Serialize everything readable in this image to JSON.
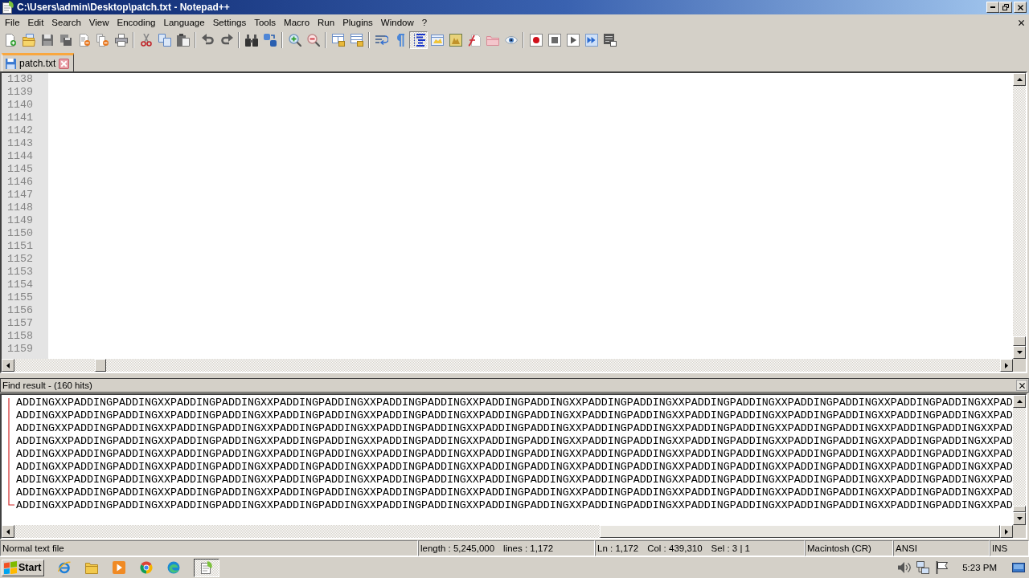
{
  "window": {
    "title": "C:\\Users\\admin\\Desktop\\patch.txt - Notepad++"
  },
  "menu": [
    "File",
    "Edit",
    "Search",
    "View",
    "Encoding",
    "Language",
    "Settings",
    "Tools",
    "Macro",
    "Run",
    "Plugins",
    "Window",
    "?"
  ],
  "toolbar": [
    [
      {
        "on": false
      },
      {
        "on": false
      },
      {
        "on": false
      },
      {
        "on": false
      },
      {
        "on": false
      },
      {
        "on": false
      },
      {
        "on": false
      }
    ],
    [
      {
        "on": false
      },
      {
        "on": false
      },
      {
        "on": false
      }
    ],
    [
      {
        "on": false
      },
      {
        "on": false
      }
    ],
    [
      {
        "on": false
      },
      {
        "on": false
      }
    ],
    [
      {
        "on": false
      },
      {
        "on": false
      }
    ],
    [
      {
        "on": false
      },
      {
        "on": false
      }
    ],
    [
      {
        "on": false
      },
      {
        "on": false
      },
      {
        "on": true
      },
      {
        "on": false
      },
      {
        "on": false
      },
      {
        "on": false
      },
      {
        "on": false
      },
      {
        "on": false
      }
    ],
    [
      {
        "on": false
      },
      {
        "on": false
      },
      {
        "on": false
      },
      {
        "on": false
      },
      {
        "on": false
      }
    ]
  ],
  "tabs": [
    {
      "label": "patch.txt",
      "selected": true
    }
  ],
  "editor": {
    "line_numbers": [
      "1138",
      "1139",
      "1140",
      "1141",
      "1142",
      "1143",
      "1144",
      "1145",
      "1146",
      "1147",
      "1148",
      "1149",
      "1150",
      "1151",
      "1152",
      "1153",
      "1154",
      "1155",
      "1156",
      "1157",
      "1158",
      "1159"
    ]
  },
  "find_result": {
    "title": "Find result - (160 hits)",
    "lines": [
      "ADDINGXXPADDINGPADDINGXXPADDINGPADDINGXXPADDINGPADDINGXXPADDINGPADDINGXXPADDINGPADDINGXXPADDINGPADDINGXXPADDINGPADDINGXXPADDINGPADDINGXXPADDINGPADDINGXXPAD",
      "ADDINGXXPADDINGPADDINGXXPADDINGPADDINGXXPADDINGPADDINGXXPADDINGPADDINGXXPADDINGPADDINGXXPADDINGPADDINGXXPADDINGPADDINGXXPADDINGPADDINGXXPADDINGPADDINGXXPAD",
      "ADDINGXXPADDINGPADDINGXXPADDINGPADDINGXXPADDINGPADDINGXXPADDINGPADDINGXXPADDINGPADDINGXXPADDINGPADDINGXXPADDINGPADDINGXXPADDINGPADDINGXXPADDINGPADDINGXXPAD",
      "ADDINGXXPADDINGPADDINGXXPADDINGPADDINGXXPADDINGPADDINGXXPADDINGPADDINGXXPADDINGPADDINGXXPADDINGPADDINGXXPADDINGPADDINGXXPADDINGPADDINGXXPADDINGPADDINGXXPAD",
      "ADDINGXXPADDINGPADDINGXXPADDINGPADDINGXXPADDINGPADDINGXXPADDINGPADDINGXXPADDINGPADDINGXXPADDINGPADDINGXXPADDINGPADDINGXXPADDINGPADDINGXXPADDINGPADDINGXXPAD",
      "ADDINGXXPADDINGPADDINGXXPADDINGPADDINGXXPADDINGPADDINGXXPADDINGPADDINGXXPADDINGPADDINGXXPADDINGPADDINGXXPADDINGPADDINGXXPADDINGPADDINGXXPADDINGPADDINGXXPAD",
      "ADDINGXXPADDINGPADDINGXXPADDINGPADDINGXXPADDINGPADDINGXXPADDINGPADDINGXXPADDINGPADDINGXXPADDINGPADDINGXXPADDINGPADDINGXXPADDINGPADDINGXXPADDINGPADDINGXXPAD",
      "ADDINGXXPADDINGPADDINGXXPADDINGPADDINGXXPADDINGPADDINGXXPADDINGPADDINGXXPADDINGPADDINGXXPADDINGPADDINGXXPADDINGPADDINGXXPADDINGPADDINGXXPADDINGPADDINGXXPAD",
      "ADDINGXXPADDINGPADDINGXXPADDINGPADDINGXXPADDINGPADDINGXXPADDINGPADDINGXXPADDINGPADDINGXXPADDINGPADDINGXXPADDINGPADDINGXXPADDINGPADDINGXXPADDINGPADDINGXXPAD"
    ]
  },
  "status_bar": {
    "file_type": "Normal text file",
    "length": "length : 5,245,000",
    "lines": "lines : 1,172",
    "line": "Ln : 1,172",
    "column": "Col : 439,310",
    "selection": "Sel : 3 | 1",
    "eol": "Macintosh (CR)",
    "encoding": "ANSI",
    "mode": "INS"
  },
  "taskbar": {
    "start": "Start",
    "tasks": [
      {
        "selected": true
      }
    ],
    "clock": "5:23 PM"
  }
}
